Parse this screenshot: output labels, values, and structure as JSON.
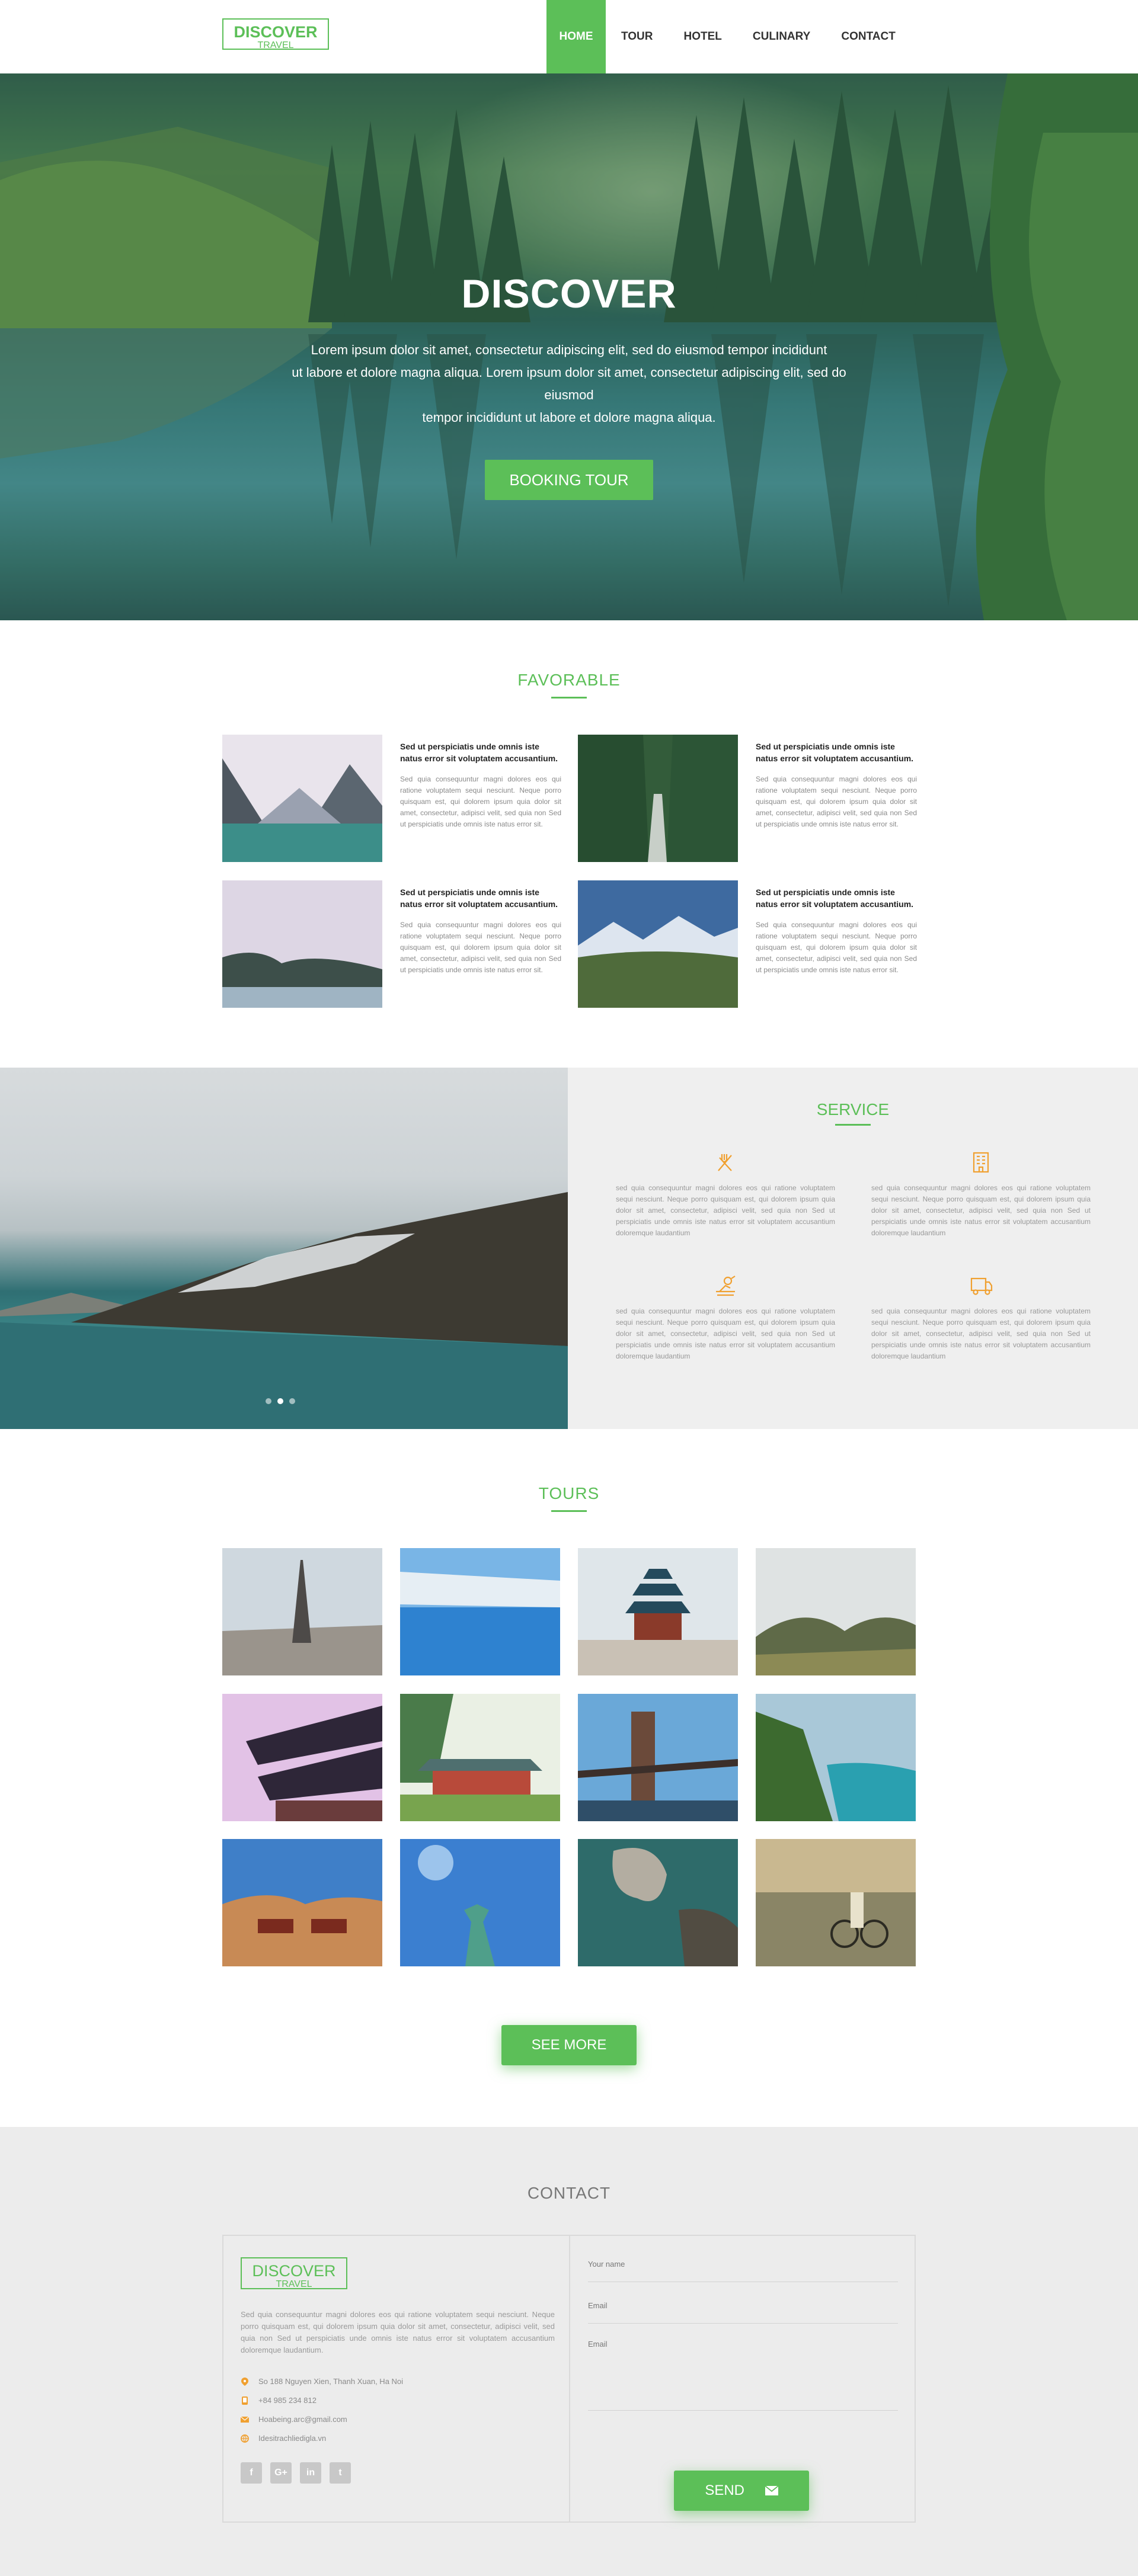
{
  "header": {
    "logo_line1": "DISCOVER",
    "logo_line2": "TRAVEL",
    "nav": [
      "HOME",
      "TOUR",
      "HOTEL",
      "CULINARY",
      "CONTACT"
    ],
    "active_nav": "HOME"
  },
  "hero": {
    "title": "DISCOVER",
    "line1": "Lorem ipsum dolor sit amet, consectetur adipiscing elit, sed do eiusmod tempor incididunt",
    "line2": "ut labore et dolore magna aliqua. Lorem ipsum dolor sit amet, consectetur adipiscing elit, sed do eiusmod",
    "line3": "tempor incididunt ut labore et dolore magna aliqua.",
    "button": "BOOKING TOUR"
  },
  "favorable": {
    "title": "FAVORABLE",
    "items": [
      {
        "heading": "Sed ut perspiciatis unde omnis iste natus error sit voluptatem accusantium.",
        "body": "Sed quia consequuntur magni dolores eos qui ratione voluptatem sequi nesciunt. Neque porro quisquam est, qui dolorem ipsum quia dolor sit amet, consectetur, adipisci velit, sed quia non Sed ut perspiciatis unde omnis iste natus error sit."
      },
      {
        "heading": "Sed ut perspiciatis unde omnis iste natus error sit voluptatem accusantium.",
        "body": "Sed quia consequuntur magni dolores eos qui ratione voluptatem sequi nesciunt. Neque porro quisquam est, qui dolorem ipsum quia dolor sit amet, consectetur, adipisci velit, sed quia non Sed ut perspiciatis unde omnis iste natus error sit."
      },
      {
        "heading": "Sed ut perspiciatis unde omnis iste natus error sit voluptatem accusantium.",
        "body": "Sed quia consequuntur magni dolores eos qui ratione voluptatem sequi nesciunt. Neque porro quisquam est, qui dolorem ipsum quia dolor sit amet, consectetur, adipisci velit, sed quia non Sed ut perspiciatis unde omnis iste natus error sit."
      },
      {
        "heading": "Sed ut perspiciatis unde omnis iste natus error sit voluptatem accusantium.",
        "body": "Sed quia consequuntur magni dolores eos qui ratione voluptatem sequi nesciunt. Neque porro quisquam est, qui dolorem ipsum quia dolor sit amet, consectetur, adipisci velit, sed quia non Sed ut perspiciatis unde omnis iste natus error sit."
      }
    ]
  },
  "service": {
    "title": "SERVICE",
    "slider_dots": 3,
    "active_dot": 2,
    "items": [
      {
        "icon": "restaurant-icon",
        "text": "sed quia consequuntur magni dolores eos qui ratione voluptatem sequi nesciunt. Neque porro quisquam est, qui dolorem ipsum quia dolor sit amet, consectetur, adipisci velit, sed quia non Sed ut perspiciatis unde omnis iste natus error sit voluptatem accusantium doloremque laudantium"
      },
      {
        "icon": "hotel-icon",
        "text": "sed quia consequuntur magni dolores eos qui ratione voluptatem sequi nesciunt. Neque porro quisquam est, qui dolorem ipsum quia dolor sit amet, consectetur, adipisci velit, sed quia non Sed ut perspiciatis unde omnis iste natus error sit voluptatem accusantium doloremque laudantium"
      },
      {
        "icon": "travel-guide-icon",
        "text": "sed quia consequuntur magni dolores eos qui ratione voluptatem sequi nesciunt. Neque porro quisquam est, qui dolorem ipsum quia dolor sit amet, consectetur, adipisci velit, sed quia non Sed ut perspiciatis unde omnis iste natus error sit voluptatem accusantium doloremque laudantium"
      },
      {
        "icon": "transport-icon",
        "text": "sed quia consequuntur magni dolores eos qui ratione voluptatem sequi nesciunt. Neque porro quisquam est, qui dolorem ipsum quia dolor sit amet, consectetur, adipisci velit, sed quia non Sed ut perspiciatis unde omnis iste natus error sit voluptatem accusantium doloremque laudantium"
      }
    ]
  },
  "tours": {
    "title": "TOURS",
    "items": [
      "paris-photo",
      "salt-flat-photo",
      "temple-of-heaven-photo",
      "misty-mountains-photo",
      "pagoda-photo",
      "forest-temple-photo",
      "bridge-photo",
      "turquoise-river-photo",
      "desert-jeeps-photo",
      "statue-of-liberty-photo",
      "coastal-rocks-photo",
      "cyclist-photo"
    ],
    "button": "SEE MORE"
  },
  "contact": {
    "title": "CONTACT",
    "logo_line1": "DISCOVER",
    "logo_line2": "TRAVEL",
    "description": "Sed quia consequuntur magni dolores eos qui ratione voluptatem sequi nesciunt. Neque porro quisquam est, qui dolorem ipsum quia dolor sit amet, consectetur, adipisci velit, sed quia non Sed ut perspiciatis unde omnis iste natus error sit voluptatem accusantium doloremque laudantium.",
    "address": "So 188 Nguyen Xien, Thanh Xuan, Ha Noi",
    "phone": "+84 985 234 812",
    "email": "Hoabeing.arc@gmail.com",
    "website": "Idesitrachliedigla.vn",
    "socials": [
      "f",
      "G+",
      "in",
      "t"
    ],
    "form": {
      "name_label": "Your name",
      "email_label": "Email",
      "message_label": "Email",
      "send_button": "SEND"
    }
  },
  "colors": {
    "accent": "#5cbf58",
    "icon_orange": "#f0a030"
  }
}
